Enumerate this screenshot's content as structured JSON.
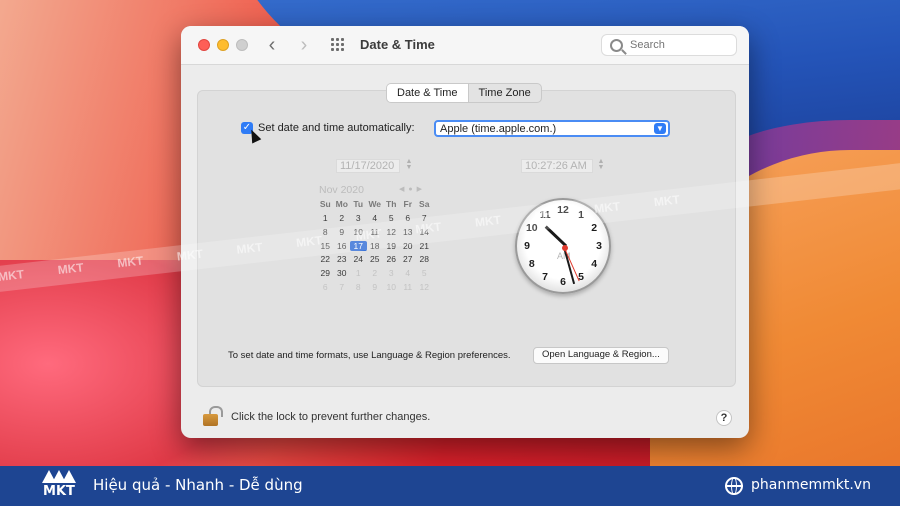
{
  "window": {
    "title": "Date & Time",
    "search_placeholder": "Search",
    "back_icon": "chevron-left-icon",
    "forward_icon": "chevron-right-icon",
    "show_all_icon": "grid-icon"
  },
  "tabs": [
    {
      "label": "Date & Time",
      "selected": true
    },
    {
      "label": "Time Zone",
      "selected": false
    }
  ],
  "auto": {
    "checked": true,
    "label": "Set date and time automatically:",
    "server": "Apple (time.apple.com.)"
  },
  "date_field": "11/17/2020",
  "time_field": "10:27:26 AM",
  "calendar": {
    "month": "Nov 2020",
    "weekdays": [
      "Su",
      "Mo",
      "Tu",
      "We",
      "Th",
      "Fr",
      "Sa"
    ],
    "weeks": [
      [
        "1",
        "2",
        "3",
        "4",
        "5",
        "6",
        "7"
      ],
      [
        "8",
        "9",
        "10",
        "11",
        "12",
        "13",
        "14"
      ],
      [
        "15",
        "16",
        "17",
        "18",
        "19",
        "20",
        "21"
      ],
      [
        "22",
        "23",
        "24",
        "25",
        "26",
        "27",
        "28"
      ],
      [
        "29",
        "30",
        "1",
        "2",
        "3",
        "4",
        "5"
      ],
      [
        "6",
        "7",
        "8",
        "9",
        "10",
        "11",
        "12"
      ]
    ],
    "selected_day": "17"
  },
  "clock": {
    "numbers": [
      "12",
      "1",
      "2",
      "3",
      "4",
      "5",
      "6",
      "7",
      "8",
      "9",
      "10",
      "11"
    ],
    "ampm": "AM",
    "hours": 10,
    "minutes": 27,
    "seconds": 26
  },
  "hint": "To set date and time formats, use Language & Region preferences.",
  "open_button": "Open Language & Region...",
  "lock_text": "Click the lock to prevent further changes.",
  "help_label": "?",
  "watermark": "MKT",
  "footer": {
    "logo": "MKT",
    "tagline": "Hiệu quả - Nhanh - Dễ dùng",
    "site": "phanmemmkt.vn"
  },
  "colors": {
    "accent": "#2f7cf6",
    "footer_bg": "#1e4592",
    "traffic_red": "#fe5f57",
    "traffic_yellow": "#febc2e"
  }
}
